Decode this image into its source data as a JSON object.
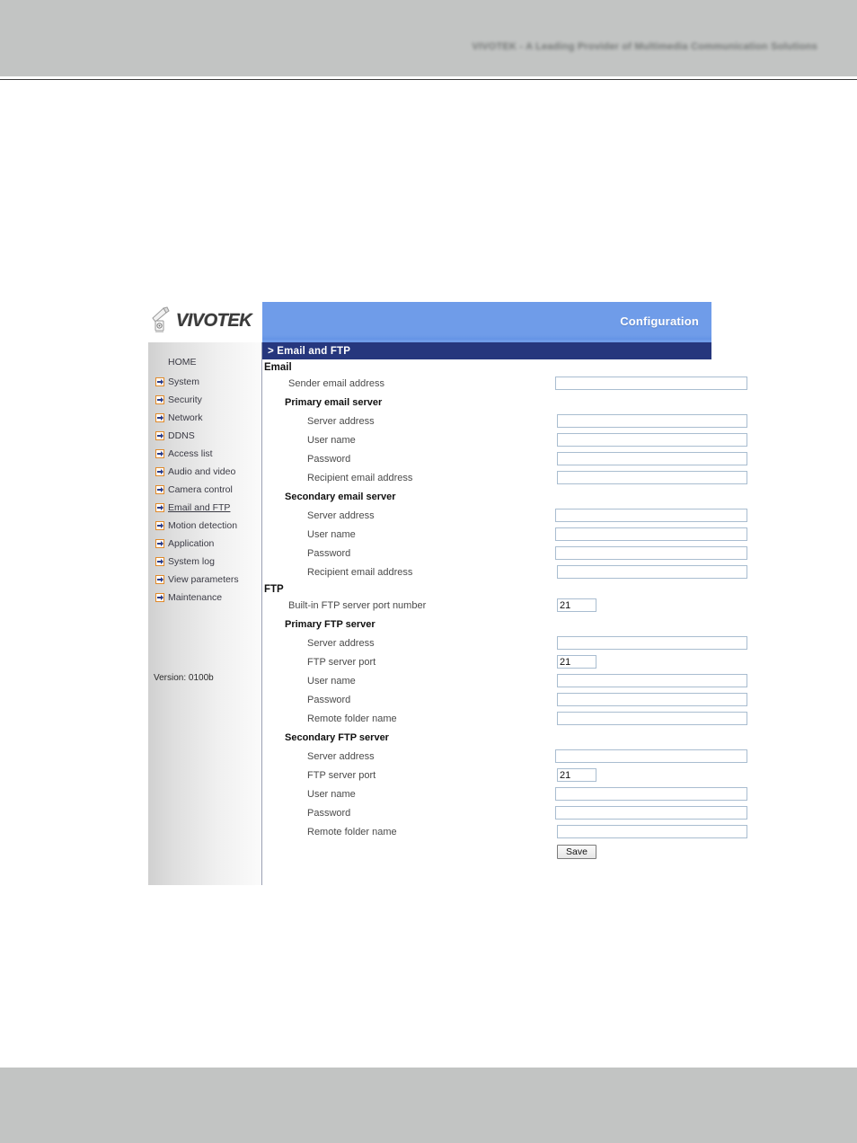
{
  "document": {
    "banner_text": "VIVOTEK - A Leading Provider of Multimedia Communication Solutions"
  },
  "colors": {
    "title_bar": "#26377d",
    "header_blue": "#6f9ce9",
    "arrow_border": "#e08a2a",
    "arrow_fill": "#2a3a86",
    "field_border": "#a9bdd0",
    "band_gray": "#c2c4c3"
  },
  "header": {
    "logo_text": "VIVOTEK",
    "logo_icon": "network-camera-icon",
    "configuration_label": "Configuration"
  },
  "sidebar": {
    "version_label": "Version: 0100b",
    "items": [
      {
        "label": "HOME",
        "icon": "none",
        "active": false
      },
      {
        "label": "System",
        "icon": "arrow-right-icon",
        "active": false
      },
      {
        "label": "Security",
        "icon": "arrow-right-icon",
        "active": false
      },
      {
        "label": "Network",
        "icon": "arrow-right-icon",
        "active": false
      },
      {
        "label": "DDNS",
        "icon": "arrow-right-icon",
        "active": false
      },
      {
        "label": "Access list",
        "icon": "arrow-right-icon",
        "active": false
      },
      {
        "label": "Audio and video",
        "icon": "arrow-right-icon",
        "active": false
      },
      {
        "label": "Camera control",
        "icon": "arrow-right-icon",
        "active": false
      },
      {
        "label": "Email and FTP",
        "icon": "arrow-right-icon",
        "active": true
      },
      {
        "label": "Motion detection",
        "icon": "arrow-right-icon",
        "active": false
      },
      {
        "label": "Application",
        "icon": "arrow-right-icon",
        "active": false
      },
      {
        "label": "System log",
        "icon": "arrow-right-icon",
        "active": false
      },
      {
        "label": "View parameters",
        "icon": "arrow-right-icon",
        "active": false
      },
      {
        "label": "Maintenance",
        "icon": "arrow-right-icon",
        "active": false
      }
    ]
  },
  "main": {
    "page_title": "> Email and FTP",
    "email": {
      "section_label": "Email",
      "sender_label": "Sender email address",
      "sender_value": "",
      "primary": {
        "heading": "Primary email server",
        "server_address_label": "Server address",
        "server_address_value": "",
        "user_name_label": "User name",
        "user_name_value": "",
        "password_label": "Password",
        "password_value": "",
        "recipient_label": "Recipient email address",
        "recipient_value": ""
      },
      "secondary": {
        "heading": "Secondary email server",
        "server_address_label": "Server address",
        "server_address_value": "",
        "user_name_label": "User name",
        "user_name_value": "",
        "password_label": "Password",
        "password_value": "",
        "recipient_label": "Recipient email address",
        "recipient_value": ""
      }
    },
    "ftp": {
      "section_label": "FTP",
      "builtin_port_label": "Built-in FTP server port number",
      "builtin_port_value": "21",
      "primary": {
        "heading": "Primary FTP server",
        "server_address_label": "Server address",
        "server_address_value": "",
        "port_label": "FTP server port",
        "port_value": "21",
        "user_name_label": "User name",
        "user_name_value": "",
        "password_label": "Password",
        "password_value": "",
        "remote_folder_label": "Remote folder name",
        "remote_folder_value": ""
      },
      "secondary": {
        "heading": "Secondary FTP server",
        "server_address_label": "Server address",
        "server_address_value": "",
        "port_label": "FTP server port",
        "port_value": "21",
        "user_name_label": "User name",
        "user_name_value": "",
        "password_label": "Password",
        "password_value": "",
        "remote_folder_label": "Remote folder name",
        "remote_folder_value": ""
      }
    },
    "save_label": "Save"
  }
}
